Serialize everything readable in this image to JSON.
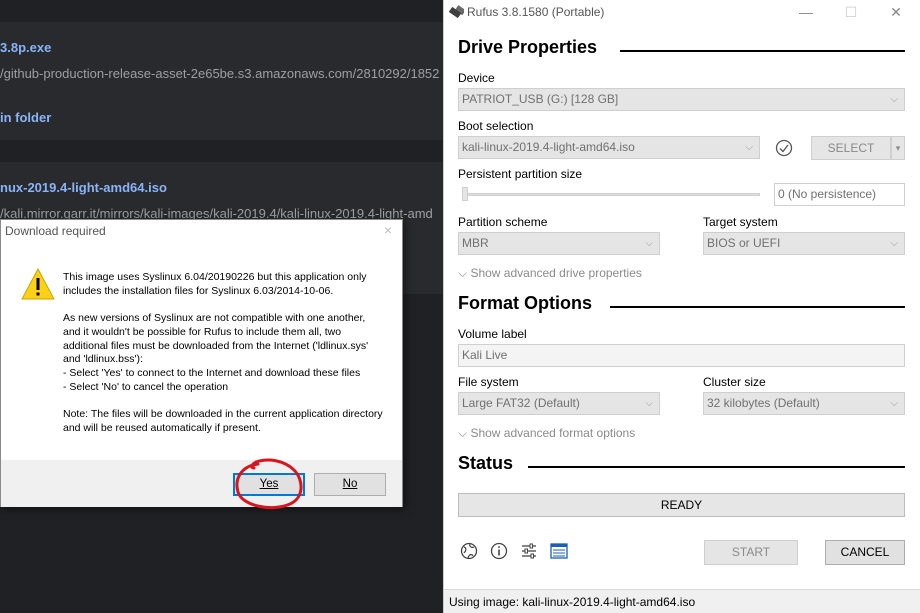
{
  "browser": {
    "downloads": [
      {
        "name": "3.8p.exe",
        "url": "/github-production-release-asset-2e65be.s3.amazonaws.com/2810292/1852",
        "action": "in folder"
      },
      {
        "name": "nux-2019.4-light-amd64.iso",
        "url": "/kali.mirror.garr.it/mirrors/kali-images/kali-2019.4/kali-linux-2019.4-light-amd"
      }
    ]
  },
  "dialog": {
    "title": "Download required",
    "close": "×",
    "paragraph1": "This image uses Syslinux 6.04/20190226 but this application only includes the installation files for Syslinux 6.03/2014-10-06.",
    "paragraph2_lines": [
      "As new versions of Syslinux are not compatible with one another,",
      "and it wouldn't be possible for Rufus to include them all, two",
      "additional files must be downloaded from the Internet ('ldlinux.sys'",
      "and 'ldlinux.bss'):",
      "- Select 'Yes' to connect to the Internet and download these files",
      "- Select 'No' to cancel the operation"
    ],
    "paragraph3": "Note: The files will be downloaded in the current application directory and will be reused automatically if present.",
    "yes": "Yes",
    "no": "No"
  },
  "rufus": {
    "title": "Rufus 3.8.1580 (Portable)",
    "window_controls": {
      "minimize": "—",
      "maximize": "☐",
      "close": "✕"
    },
    "drive_properties": {
      "heading": "Drive Properties",
      "device_label": "Device",
      "device_value": "PATRIOT_USB (G:) [128 GB]",
      "boot_label": "Boot selection",
      "boot_value": "kali-linux-2019.4-light-amd64.iso",
      "select_button": "SELECT",
      "persistent_label": "Persistent partition size",
      "persistent_value": "0 (No persistence)",
      "persistent_level": 0,
      "partition_label": "Partition scheme",
      "partition_value": "MBR",
      "target_label": "Target system",
      "target_value": "BIOS or UEFI",
      "advanced": "Show advanced drive properties"
    },
    "format_options": {
      "heading": "Format Options",
      "volume_label": "Volume label",
      "volume_value": "Kali Live",
      "fs_label": "File system",
      "fs_value": "Large FAT32 (Default)",
      "cluster_label": "Cluster size",
      "cluster_value": "32 kilobytes (Default)",
      "advanced": "Show advanced format options"
    },
    "status": {
      "heading": "Status",
      "value": "READY",
      "progress": 0
    },
    "start": "START",
    "cancel": "CANCEL",
    "footer": "Using image: kali-linux-2019.4-light-amd64.iso"
  }
}
